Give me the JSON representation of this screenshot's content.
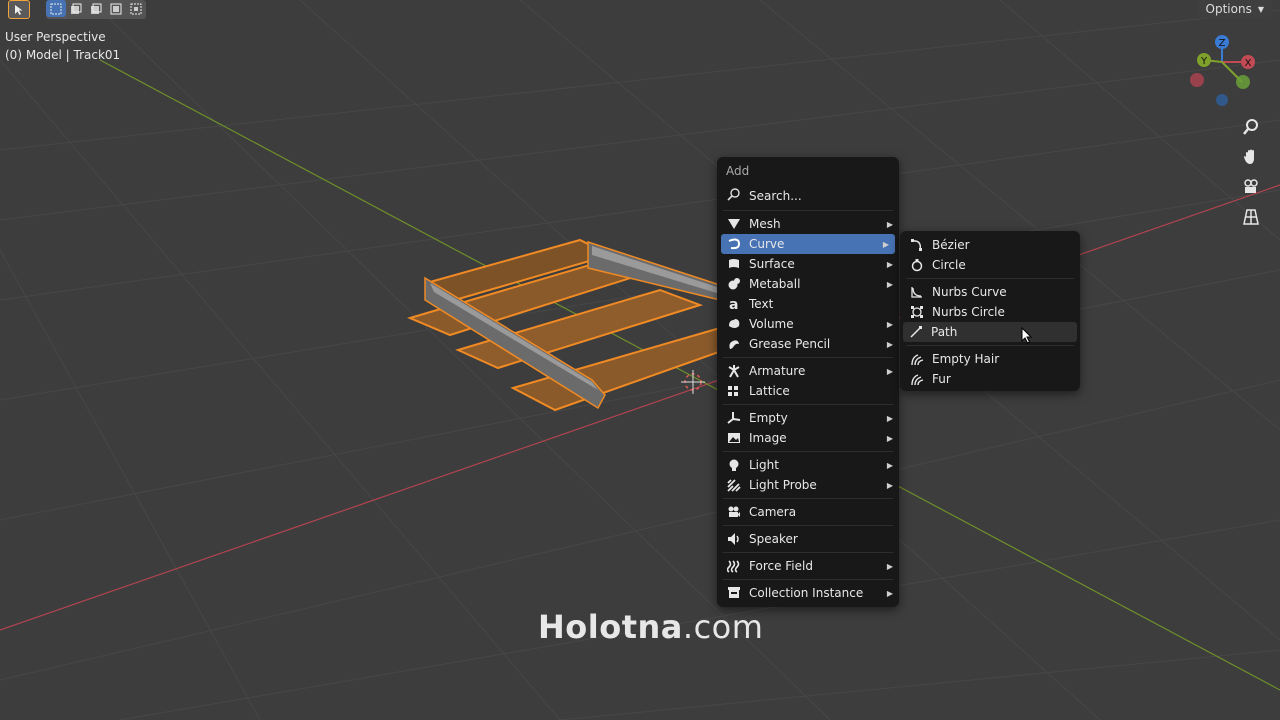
{
  "viewport": {
    "perspective_label": "User Perspective",
    "object_label": "(0) Model | Track01",
    "options_label": "Options"
  },
  "gizmo": {
    "z": "Z",
    "y": "Y",
    "x": "X"
  },
  "add_menu": {
    "title": "Add",
    "search": "Search...",
    "items": [
      {
        "label": "Mesh",
        "icon": "mesh-icon",
        "submenu": true
      },
      {
        "label": "Curve",
        "icon": "curve-icon",
        "submenu": true
      },
      {
        "label": "Surface",
        "icon": "surface-icon",
        "submenu": true
      },
      {
        "label": "Metaball",
        "icon": "metaball-icon",
        "submenu": true
      },
      {
        "label": "Text",
        "icon": "text-icon",
        "submenu": false
      },
      {
        "label": "Volume",
        "icon": "volume-icon",
        "submenu": true
      },
      {
        "label": "Grease Pencil",
        "icon": "grease-pencil-icon",
        "submenu": true
      },
      {
        "label": "Armature",
        "icon": "armature-icon",
        "submenu": true
      },
      {
        "label": "Lattice",
        "icon": "lattice-icon",
        "submenu": false
      },
      {
        "label": "Empty",
        "icon": "empty-icon",
        "submenu": true
      },
      {
        "label": "Image",
        "icon": "image-icon",
        "submenu": true
      },
      {
        "label": "Light",
        "icon": "light-icon",
        "submenu": true
      },
      {
        "label": "Light Probe",
        "icon": "light-probe-icon",
        "submenu": true
      },
      {
        "label": "Camera",
        "icon": "camera-icon",
        "submenu": false
      },
      {
        "label": "Speaker",
        "icon": "speaker-icon",
        "submenu": false
      },
      {
        "label": "Force Field",
        "icon": "force-field-icon",
        "submenu": true
      },
      {
        "label": "Collection Instance",
        "icon": "collection-instance-icon",
        "submenu": true
      }
    ]
  },
  "curve_submenu": {
    "items": [
      {
        "label": "Bézier",
        "icon": "bezier-icon"
      },
      {
        "label": "Circle",
        "icon": "circle-curve-icon"
      },
      {
        "label": "Nurbs Curve",
        "icon": "nurbs-curve-icon"
      },
      {
        "label": "Nurbs Circle",
        "icon": "nurbs-circle-icon"
      },
      {
        "label": "Path",
        "icon": "path-icon"
      },
      {
        "label": "Empty Hair",
        "icon": "empty-hair-icon"
      },
      {
        "label": "Fur",
        "icon": "fur-icon"
      }
    ]
  },
  "watermark": {
    "brand": "Holotna",
    "tld": ".com"
  },
  "colors": {
    "background": "#3d3d3d",
    "menu_bg": "#181818",
    "highlight": "#4772b3",
    "selection_outline": "#f08a24",
    "x_axis": "#c24a55",
    "y_axis": "#7fa12c",
    "z_axis": "#3a7bd5"
  }
}
